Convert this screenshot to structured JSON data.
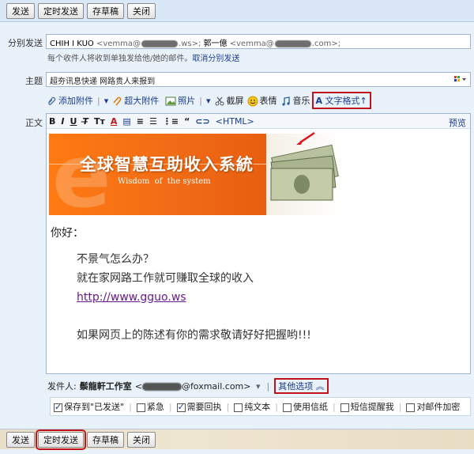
{
  "toolbar": {
    "send": "发送",
    "scheduled_send": "定时发送",
    "save_draft": "存草稿",
    "close": "关闭"
  },
  "recipients": {
    "label": "分别发送",
    "items": [
      {
        "name": "CHIH I KUO",
        "addr_pre": "<vemma@",
        "addr_post": ".ws>;"
      },
      {
        "name": "郭一億",
        "addr_pre": "<vemma@",
        "addr_post": ".com>;"
      }
    ],
    "hint": "每个收件人将收到单独发给他/她的邮件。",
    "cancel_link": "取消分别发送"
  },
  "subject": {
    "label": "主题",
    "value": "超夯讯息快递  网路贵人来报到"
  },
  "attach_bar": {
    "add_attachment": "添加附件",
    "super_attachment": "超大附件",
    "photo": "照片",
    "screenshot": "截屏",
    "emoji": "表情",
    "music": "音乐",
    "text_format": "文字格式↑"
  },
  "editor": {
    "label": "正文",
    "html_link": "<HTML>",
    "preview": "预览",
    "banner_title": "全球智慧互助收入系統",
    "banner_subtitle": "Wisdom  of  the system",
    "greeting": "你好：",
    "line1": "不景气怎么办？",
    "line2": "就在家网路工作就可赚取全球的收入",
    "url": "http://www.gguo.ws",
    "line3": "如果网页上的陈述有你的需求敬请好好把握哟!!!"
  },
  "sender": {
    "label": "发件人:",
    "studio": "鬃龍軒工作室",
    "email_suffix": "@foxmail.com>",
    "other_options": "其他选项"
  },
  "options": [
    {
      "label": "保存到\"已发送\"",
      "checked": true
    },
    {
      "label": "紧急",
      "checked": false
    },
    {
      "label": "需要回执",
      "checked": true
    },
    {
      "label": "纯文本",
      "checked": false
    },
    {
      "label": "使用信纸",
      "checked": false
    },
    {
      "label": "短信提醒我",
      "checked": false
    },
    {
      "label": "对邮件加密",
      "checked": false
    }
  ],
  "colors": {
    "accent_red": "#c0141c",
    "link_blue": "#1a3d8f",
    "banner_orange": "#f07a1a"
  }
}
